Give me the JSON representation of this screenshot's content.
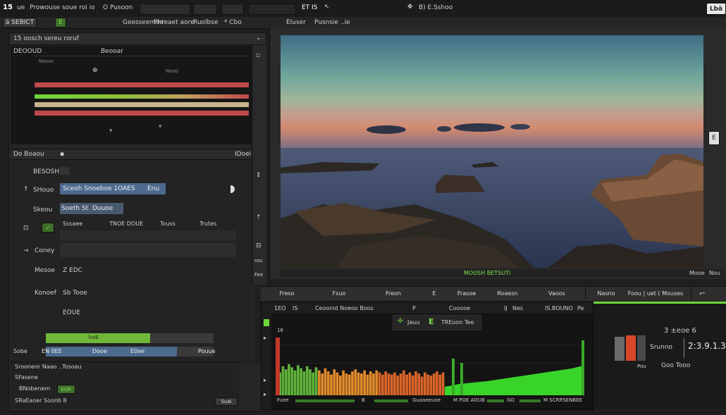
{
  "menubar": {
    "logo": "15",
    "items": [
      "ue",
      "Prowouse soue roi iors",
      "Ö Pusoon"
    ],
    "center": "ET IŠ",
    "right": "B) E.Sshoo",
    "corner": "Lbä"
  },
  "toolbar": {
    "items": [
      "ä SEBICT",
      "Geesseemoe",
      "Phreaet aore",
      "Ruolbse",
      "* Cbo",
      "Eluser",
      "Pusnsie ..ie"
    ],
    "green_label": "E"
  },
  "left_panel": {
    "title": "15 oosch sereu roruf",
    "timeline_label": "DEOOUD",
    "timeline_title": "Beooar",
    "ruler": [
      "Nosac",
      "Nooo"
    ],
    "section_label": "Do Boaou",
    "section_right": "IDoei",
    "rows": [
      {
        "label": "BESOSH",
        "value": ""
      },
      {
        "label": "SHouo",
        "value": "Sceoh Snoeboe 1OAES",
        "right": "Enu"
      },
      {
        "label": "Skeou",
        "value": "Soeth St. Duuoe"
      },
      {
        "label": "",
        "value": "Sssaee",
        "cols": [
          "TNOE DOUE",
          "Touss",
          "Trutes"
        ]
      },
      {
        "label": "Coney",
        "value": ""
      },
      {
        "label": "Mesoe",
        "value": "Z EDC"
      },
      {
        "label": "Konoef",
        "value": "Sb Tooe"
      },
      {
        "label": "",
        "value": "EOUE"
      }
    ],
    "progress1": {
      "label": "SoiE",
      "fraction": 0.62
    },
    "progress2": {
      "label": "Sobe",
      "left": "EN 0EE",
      "mid": "Dooe",
      "right": "E0ee",
      "end": "Pouue",
      "fraction": 0.78
    },
    "footer": [
      "Sroonenr  Naao ..Tosoau",
      "SFasene",
      "BNobenem",
      "EOR",
      "SRaEaoer  Soonb 8",
      "Suai"
    ]
  },
  "side_strip": [
    "rou",
    "Fee"
  ],
  "viewer": {
    "status_text": "MOUSH BETSUTI",
    "status_right": "Mooe",
    "status_far": "Nou",
    "badge": "E"
  },
  "bottom_tabs": [
    "Freso",
    "Fsuo",
    "Freon",
    "E",
    "Frasoe",
    "Roaesn",
    "Vaoos"
  ],
  "bottom_tabs_right": [
    "Nasno",
    "Foou | uet ( Mouses"
  ],
  "scope": {
    "header": [
      "1EO",
      "IS",
      "Ceoonid Noeoo  Boos",
      "P",
      "Cooooe",
      "IJ",
      "Nes",
      "IS.BOUNO",
      "Pe"
    ],
    "overlay_left": "Jauu",
    "overlay_mid": "E",
    "overlay_right": "TREoon  Tee",
    "top_tick": "16",
    "axis_labels": [
      "Fuee",
      "B",
      "Guaaeeuoe",
      "M POE AOUB",
      "GO",
      "M SCRRSENBEE"
    ],
    "bars": [
      0.15,
      0.22,
      0.28,
      0.25,
      0.3,
      0.27,
      0.24,
      0.29,
      0.26,
      0.23,
      0.28,
      0.25,
      0.22,
      0.27,
      0.24,
      0.21,
      0.26,
      0.23,
      0.2,
      0.25,
      0.22,
      0.19,
      0.24,
      0.21,
      0.2,
      0.23,
      0.25,
      0.22,
      0.21,
      0.24,
      0.2,
      0.23,
      0.21,
      0.24,
      0.22,
      0.2,
      0.23,
      0.21,
      0.2,
      0.22,
      0.19,
      0.21,
      0.24,
      0.2,
      0.22,
      0.19,
      0.23,
      0.21,
      0.18,
      0.22,
      0.2,
      0.19,
      0.21,
      0.23,
      0.2,
      0.22
    ]
  },
  "meter": {
    "top": "3 ±eoe 6",
    "label": "Srunno",
    "value": "2:3.9.1.3",
    "left_caption": "Pou",
    "right_caption": "Goo Tooo"
  },
  "colors": {
    "accent_green": "#6fd83a",
    "red_track": "#c0494a",
    "blue_field": "#4d6a8e"
  }
}
